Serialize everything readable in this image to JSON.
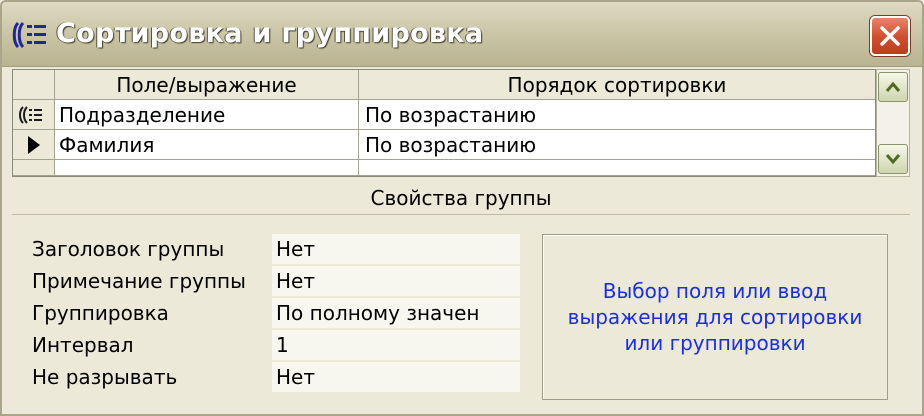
{
  "window": {
    "title": "Сортировка и группировка",
    "icons": {
      "title": "sorting-grouping-icon",
      "close": "close-icon"
    }
  },
  "grid": {
    "headers": {
      "field": "Поле/выражение",
      "order": "Порядок сортировки"
    },
    "rows": [
      {
        "field": "Подразделение",
        "order": "По возрастанию",
        "selector_icon": "grouping-icon"
      },
      {
        "field": "Фамилия",
        "order": "По возрастанию",
        "selector_icon": "current-row-arrow-icon"
      },
      {
        "field": "",
        "order": ""
      }
    ]
  },
  "group_properties": {
    "title": "Свойства группы",
    "items": [
      {
        "label": "Заголовок группы",
        "value": "Нет"
      },
      {
        "label": "Примечание группы",
        "value": "Нет"
      },
      {
        "label": "Группировка",
        "value": "По полному значен"
      },
      {
        "label": "Интервал",
        "value": "1"
      },
      {
        "label": "Не разрывать",
        "value": "Нет"
      }
    ],
    "hint": "Выбор поля или ввод выражения для сортировки или группировки"
  },
  "colors": {
    "hint_text": "#1a2ee8",
    "close_button": "#d2502f"
  }
}
